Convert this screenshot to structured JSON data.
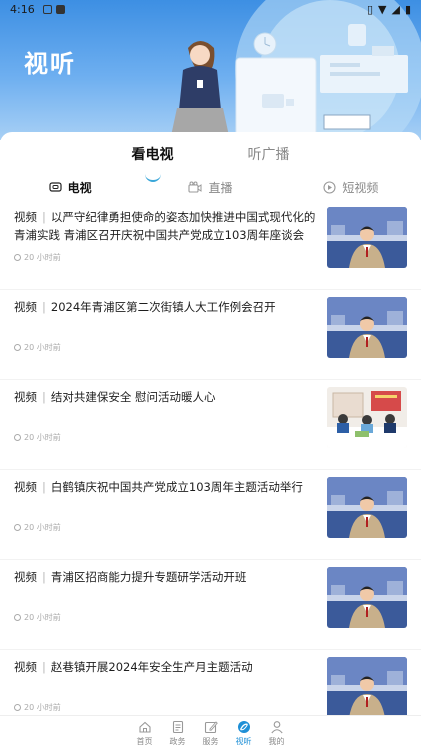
{
  "status_bar": {
    "time": "4:16"
  },
  "header": {
    "title": "视听"
  },
  "main_tabs": [
    {
      "label": "看电视",
      "active": true
    },
    {
      "label": "听广播",
      "active": false
    }
  ],
  "sub_tabs": [
    {
      "label": "电视",
      "icon": "tv-icon",
      "active": true
    },
    {
      "label": "直播",
      "icon": "live-camera-icon",
      "active": false
    },
    {
      "label": "短视频",
      "icon": "short-video-icon",
      "active": false
    }
  ],
  "news": [
    {
      "tag": "视频",
      "title": "以严守纪律勇担使命的姿态加快推进中国式现代化的青浦实践 青浦区召开庆祝中国共产党成立103周年座谈会",
      "time": "20 小时前",
      "thumb": "anchor"
    },
    {
      "tag": "视频",
      "title": "2024年青浦区第二次街镇人大工作例会召开",
      "time": "20 小时前",
      "thumb": "anchor"
    },
    {
      "tag": "视频",
      "title": "结对共建保安全 慰问活动暖人心",
      "time": "20 小时前",
      "thumb": "meeting"
    },
    {
      "tag": "视频",
      "title": "白鹤镇庆祝中国共产党成立103周年主题活动举行",
      "time": "20 小时前",
      "thumb": "anchor"
    },
    {
      "tag": "视频",
      "title": "青浦区招商能力提升专题研学活动开班",
      "time": "20 小时前",
      "thumb": "anchor"
    },
    {
      "tag": "视频",
      "title": "赵巷镇开展2024年安全生产月主题活动",
      "time": "20 小时前",
      "thumb": "anchor"
    }
  ],
  "bottom_nav": [
    {
      "label": "首页",
      "icon": "home-icon",
      "active": false
    },
    {
      "label": "政务",
      "icon": "document-icon",
      "active": false
    },
    {
      "label": "服务",
      "icon": "edit-icon",
      "active": false
    },
    {
      "label": "视听",
      "icon": "media-icon",
      "active": true
    },
    {
      "label": "我的",
      "icon": "user-icon",
      "active": false
    }
  ],
  "colors": {
    "accent": "#1e8fd6",
    "hero_top": "#3d8fe3",
    "hero_bottom": "#a8d0f5"
  }
}
